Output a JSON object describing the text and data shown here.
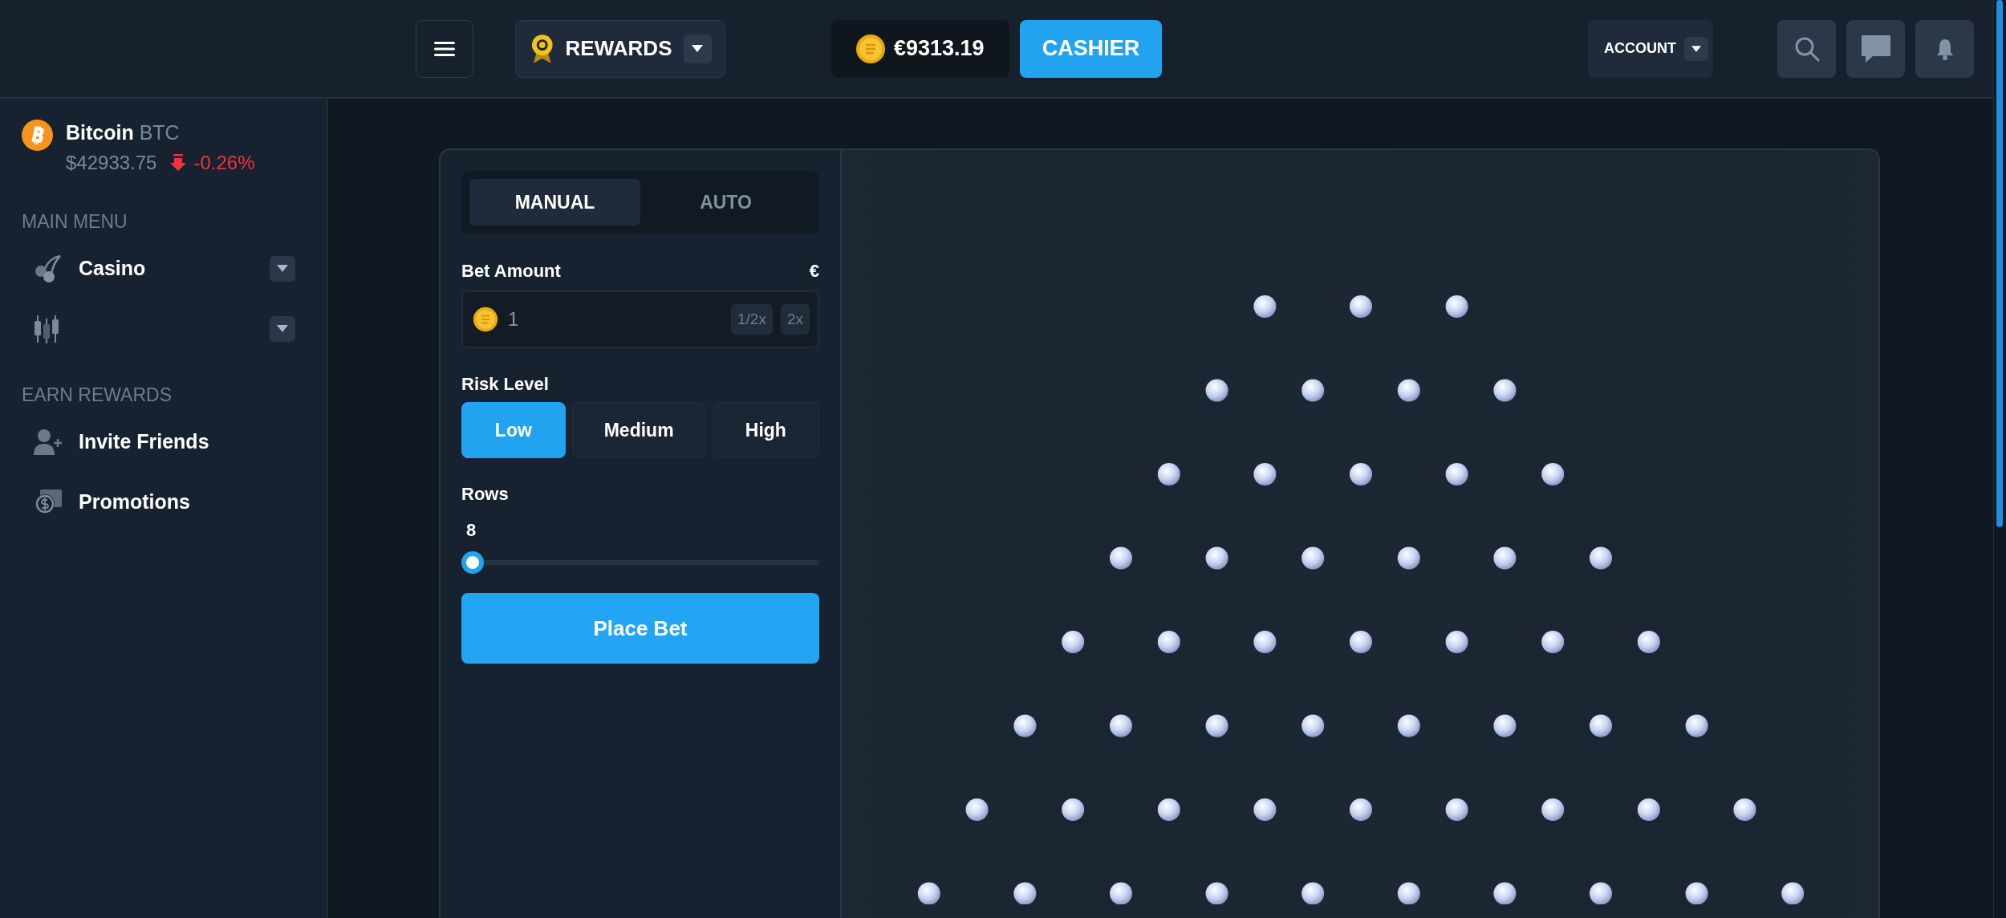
{
  "header": {
    "rewards": "REWARDS",
    "balance": "€9313.19",
    "cashier": "CASHIER",
    "account": "ACCOUNT"
  },
  "sidebar": {
    "ticker": {
      "name": "Bitcoin",
      "symbol": "BTC",
      "price": "$42933.75",
      "change": "-0.26%",
      "falling": true
    },
    "sections": [
      {
        "title": "MAIN MENU",
        "items": [
          {
            "label": "Casino",
            "kind": "dropdown"
          },
          {
            "kind": "dropdown"
          }
        ]
      },
      {
        "title": "EARN REWARDS",
        "items": [
          {
            "label": "Invite Friends",
            "kind": "link"
          },
          {
            "label": "Promotions",
            "kind": "link"
          }
        ]
      }
    ]
  },
  "bet_panel": {
    "tabs": [
      {
        "label": "MANUAL",
        "selected": true
      },
      {
        "label": "AUTO",
        "selected": false
      }
    ],
    "bet_amount": {
      "label": "Bet Amount",
      "currency": "€",
      "value": "1",
      "buttons": [
        "1/2x",
        "2x"
      ]
    },
    "risk": {
      "label": "Risk Level",
      "options": [
        {
          "label": "Low",
          "selected": true
        },
        {
          "label": "Medium",
          "selected": false
        },
        {
          "label": "High",
          "selected": false
        }
      ]
    },
    "rows": {
      "label": "Rows",
      "value": "8",
      "level": 0
    },
    "place_bet": "Place Bet"
  }
}
